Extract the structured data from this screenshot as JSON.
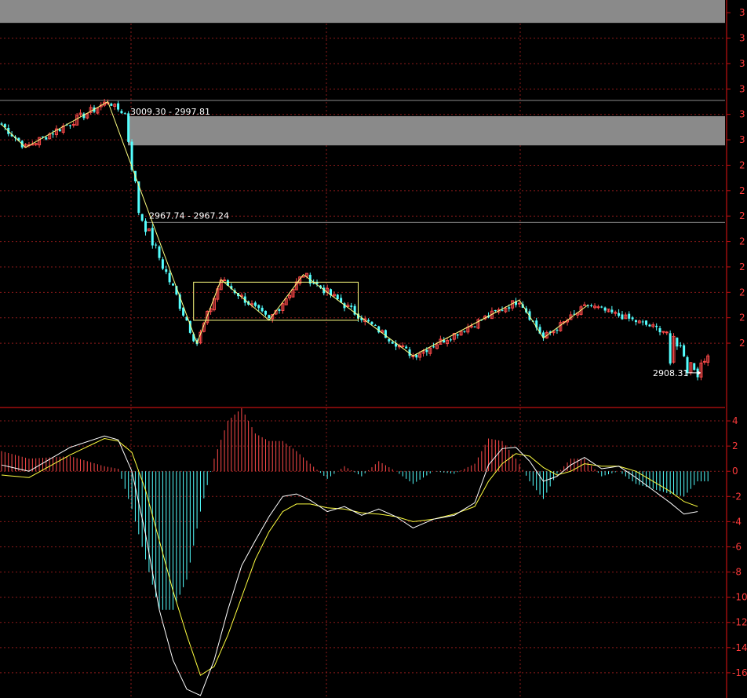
{
  "colors": {
    "background": "#000000",
    "grid": "#8b1a1a",
    "up_candle": "#ff4a4a",
    "down_candle": "#54ffff",
    "zigzag": "#ffff80",
    "dif_line": "#ffffff",
    "dea_line": "#ffff40",
    "zone": "#8a8a8a",
    "axis_text": "#ff3b3b"
  },
  "price_panel": {
    "ylim": [
      2895,
      3055
    ],
    "tick_labels": [
      "3",
      "3",
      "3",
      "3",
      "3",
      "3",
      "2",
      "2",
      "2",
      "2",
      "2",
      "2",
      "2",
      "2"
    ],
    "annotations": {
      "upper_range": "3009.30 - 2997.81",
      "mid_range": "2967.74 - 2967.24",
      "low_price": "2908.31"
    }
  },
  "macd_panel": {
    "ylim": [
      -18,
      5
    ],
    "tick_labels": [
      "4",
      "2",
      "0",
      "-2",
      "-4",
      "-6",
      "-8",
      "-10",
      "-12",
      "-14",
      "-16"
    ]
  },
  "chart_data": [
    {
      "type": "candlestick",
      "title": "",
      "xlabel": "",
      "ylabel": "",
      "ylim": [
        2895,
        3055
      ],
      "grid": true,
      "zones": [
        {
          "low": 3046,
          "high": 3060
        },
        {
          "low": 2997.81,
          "high": 3009.3
        }
      ],
      "levels": [
        3015.5,
        2967.5
      ],
      "range_labels": [
        {
          "text": "3009.30 - 2997.81",
          "price": 3009.3
        },
        {
          "text": "2967.74 - 2967.24",
          "price": 2967.74
        }
      ],
      "low_label": {
        "text": "2908.31",
        "price": 2908.31
      },
      "consolidation_box": {
        "x_from": 56,
        "x_to": 104,
        "high": 2944,
        "low": 2929
      },
      "zigzag": [
        {
          "x": 0,
          "price": 3006
        },
        {
          "x": 7,
          "price": 2997
        },
        {
          "x": 31,
          "price": 3015
        },
        {
          "x": 57,
          "price": 2920
        },
        {
          "x": 64,
          "price": 2945
        },
        {
          "x": 78,
          "price": 2929
        },
        {
          "x": 88,
          "price": 2947
        },
        {
          "x": 104,
          "price": 2931
        },
        {
          "x": 120,
          "price": 2915
        },
        {
          "x": 151,
          "price": 2937
        },
        {
          "x": 158,
          "price": 2922
        },
        {
          "x": 171,
          "price": 2935
        }
      ],
      "series": [
        {
          "ohlc_segments": [
            {
              "from": 0,
              "to": 7,
              "start": 3006,
              "end": 2997,
              "vol": 1.5
            },
            {
              "from": 7,
              "to": 31,
              "start": 2997,
              "end": 3015,
              "vol": 1.6
            },
            {
              "from": 31,
              "to": 36,
              "start": 3015,
              "end": 3010,
              "vol": 1.0
            },
            {
              "from": 36,
              "to": 40,
              "start": 3010,
              "end": 2972,
              "vol": 4.0
            },
            {
              "from": 40,
              "to": 57,
              "start": 2972,
              "end": 2920,
              "vol": 2.5
            },
            {
              "from": 57,
              "to": 64,
              "start": 2920,
              "end": 2945,
              "vol": 2.0
            },
            {
              "from": 64,
              "to": 78,
              "start": 2945,
              "end": 2929,
              "vol": 1.5
            },
            {
              "from": 78,
              "to": 88,
              "start": 2929,
              "end": 2947,
              "vol": 1.8
            },
            {
              "from": 88,
              "to": 104,
              "start": 2947,
              "end": 2931,
              "vol": 1.6
            },
            {
              "from": 104,
              "to": 120,
              "start": 2931,
              "end": 2915,
              "vol": 1.4
            },
            {
              "from": 120,
              "to": 151,
              "start": 2915,
              "end": 2937,
              "vol": 1.5
            },
            {
              "from": 151,
              "to": 158,
              "start": 2937,
              "end": 2922,
              "vol": 1.5
            },
            {
              "from": 158,
              "to": 171,
              "start": 2922,
              "end": 2935,
              "vol": 1.4
            },
            {
              "from": 171,
              "to": 195,
              "start": 2935,
              "end": 2924,
              "vol": 1.2
            },
            {
              "from": 195,
              "to": 203,
              "start": 2924,
              "end": 2908.31,
              "vol": 2.0
            },
            {
              "from": 203,
              "to": 206,
              "start": 2908.31,
              "end": 2915,
              "vol": 1.8
            }
          ],
          "bars": 207
        }
      ]
    },
    {
      "type": "macd",
      "title": "",
      "xlabel": "",
      "ylabel": "",
      "ylim": [
        -18,
        5
      ],
      "grid": true,
      "series": [
        {
          "key": "dif",
          "points": [
            [
              0,
              0.5
            ],
            [
              8,
              0.0
            ],
            [
              20,
              1.9
            ],
            [
              30,
              2.8
            ],
            [
              34,
              2.5
            ],
            [
              38,
              0
            ],
            [
              42,
              -5
            ],
            [
              46,
              -11
            ],
            [
              50,
              -15
            ],
            [
              54,
              -17.3
            ],
            [
              58,
              -17.8
            ],
            [
              62,
              -15
            ],
            [
              66,
              -11
            ],
            [
              70,
              -7.5
            ],
            [
              74,
              -5.5
            ],
            [
              78,
              -3.6
            ],
            [
              82,
              -2
            ],
            [
              86,
              -1.8
            ],
            [
              90,
              -2.3
            ],
            [
              95,
              -3.2
            ],
            [
              100,
              -2.8
            ],
            [
              105,
              -3.5
            ],
            [
              110,
              -3.0
            ],
            [
              115,
              -3.6
            ],
            [
              120,
              -4.5
            ],
            [
              126,
              -3.8
            ],
            [
              132,
              -3.5
            ],
            [
              138,
              -2.5
            ],
            [
              142,
              0.5
            ],
            [
              146,
              1.8
            ],
            [
              150,
              1.9
            ],
            [
              154,
              0.8
            ],
            [
              158,
              -0.8
            ],
            [
              162,
              -0.4
            ],
            [
              166,
              0.5
            ],
            [
              170,
              1.1
            ],
            [
              175,
              0.2
            ],
            [
              180,
              0.4
            ],
            [
              185,
              -0.5
            ],
            [
              190,
              -1.5
            ],
            [
              195,
              -2.5
            ],
            [
              199,
              -3.4
            ],
            [
              203,
              -3.2
            ]
          ]
        },
        {
          "key": "dea",
          "points": [
            [
              0,
              -0.3
            ],
            [
              8,
              -0.5
            ],
            [
              20,
              1.3
            ],
            [
              30,
              2.6
            ],
            [
              34,
              2.4
            ],
            [
              38,
              1.5
            ],
            [
              42,
              -1.5
            ],
            [
              46,
              -5.5
            ],
            [
              50,
              -9.5
            ],
            [
              54,
              -13
            ],
            [
              58,
              -16.2
            ],
            [
              62,
              -15.5
            ],
            [
              66,
              -13
            ],
            [
              70,
              -10
            ],
            [
              74,
              -7
            ],
            [
              78,
              -4.8
            ],
            [
              82,
              -3.2
            ],
            [
              86,
              -2.6
            ],
            [
              90,
              -2.6
            ],
            [
              95,
              -2.9
            ],
            [
              100,
              -3.0
            ],
            [
              105,
              -3.3
            ],
            [
              110,
              -3.4
            ],
            [
              115,
              -3.6
            ],
            [
              120,
              -4.0
            ],
            [
              126,
              -3.8
            ],
            [
              132,
              -3.4
            ],
            [
              138,
              -2.8
            ],
            [
              142,
              -0.8
            ],
            [
              146,
              0.6
            ],
            [
              150,
              1.4
            ],
            [
              154,
              1.2
            ],
            [
              158,
              0.3
            ],
            [
              162,
              -0.3
            ],
            [
              166,
              0.0
            ],
            [
              170,
              0.6
            ],
            [
              175,
              0.4
            ],
            [
              180,
              0.4
            ],
            [
              185,
              0.0
            ],
            [
              190,
              -0.8
            ],
            [
              195,
              -1.6
            ],
            [
              199,
              -2.4
            ],
            [
              203,
              -2.8
            ]
          ]
        }
      ]
    }
  ]
}
